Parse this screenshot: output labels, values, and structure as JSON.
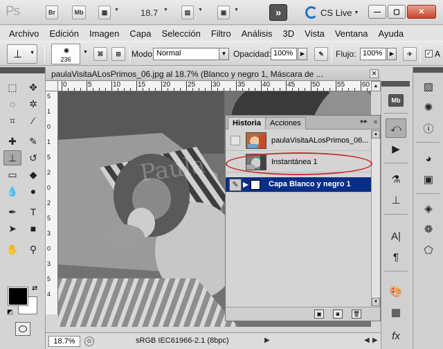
{
  "app": {
    "logo": "Ps",
    "bridge_label": "Br",
    "minibridge_label": "Mb",
    "zoom": "18.7",
    "arrange_label": "»",
    "cs_live": "CS Live",
    "dropdown_glyph": "▼",
    "minimize_glyph": "—",
    "restore_glyph": "▢",
    "close_glyph": "✕"
  },
  "menu": [
    "Archivo",
    "Edición",
    "Imagen",
    "Capa",
    "Selección",
    "Filtro",
    "Análisis",
    "3D",
    "Vista",
    "Ventana",
    "Ayuda"
  ],
  "options": {
    "brush_size": "236",
    "mode_label": "Modo:",
    "mode_value": "Normal",
    "opacity_label": "Opacidad:",
    "opacity_value": "100%",
    "flow_label": "Flujo:",
    "flow_value": "100%",
    "arrow_glyph": "▶",
    "checkbox_glyph": "✓",
    "trailing_label": "A"
  },
  "document": {
    "tab_title": "paulaVisitaALosPrimos_06.jpg al 18.7% (Blanco y negro 1, Máscara de ...",
    "close_glyph": "✕",
    "ruler_h": [
      "0",
      "5",
      "10",
      "15",
      "20",
      "25",
      "30",
      "35",
      "40",
      "45",
      "50",
      "55",
      "60"
    ],
    "ruler_v": [
      "5",
      "1",
      "0",
      "1",
      "5",
      "2",
      "0",
      "2",
      "5",
      "3",
      "0",
      "3",
      "5",
      "4"
    ],
    "status_zoom": "18.7%",
    "status_text": "sRGB IEC61966-2.1 (8bpc)",
    "watermark": "Paula"
  },
  "history_panel": {
    "tabs": [
      "Historia",
      "Acciones"
    ],
    "menu_glyph": "▸▸",
    "options_glyph": "≡",
    "rows": [
      {
        "label": "paulaVisitaALosPrimos_06..."
      },
      {
        "label": "Instantánea 1"
      },
      {
        "label": "Capa Blanco y negro 1"
      }
    ]
  },
  "tools": [
    {
      "name": "rectangular-marquee-icon",
      "glyph": "⬚"
    },
    {
      "name": "move-icon",
      "glyph": "✥"
    },
    {
      "name": "lasso-icon",
      "glyph": "◌"
    },
    {
      "name": "magic-wand-icon",
      "glyph": "✲"
    },
    {
      "name": "crop-icon",
      "glyph": "⌗"
    },
    {
      "name": "eyedropper-icon",
      "glyph": "⁄"
    },
    {
      "name": "healing-brush-icon",
      "glyph": "✚"
    },
    {
      "name": "brush-icon",
      "glyph": "✎"
    },
    {
      "name": "clone-stamp-icon",
      "glyph": "⊥"
    },
    {
      "name": "history-brush-icon",
      "glyph": "↺"
    },
    {
      "name": "eraser-icon",
      "glyph": "▭"
    },
    {
      "name": "paint-bucket-icon",
      "glyph": "◆"
    },
    {
      "name": "blur-icon",
      "glyph": "💧"
    },
    {
      "name": "dodge-icon",
      "glyph": "●"
    },
    {
      "name": "pen-icon",
      "glyph": "✒"
    },
    {
      "name": "type-icon",
      "glyph": "T"
    },
    {
      "name": "path-selection-icon",
      "glyph": "➤"
    },
    {
      "name": "rectangle-shape-icon",
      "glyph": "■"
    },
    {
      "name": "hand-icon",
      "glyph": "✋"
    },
    {
      "name": "zoom-icon",
      "glyph": "⚲"
    }
  ],
  "colors": {
    "selection": "#082e88",
    "highlight_ring": "#c9302c",
    "foreground": "#000000",
    "background": "#ffffff"
  }
}
